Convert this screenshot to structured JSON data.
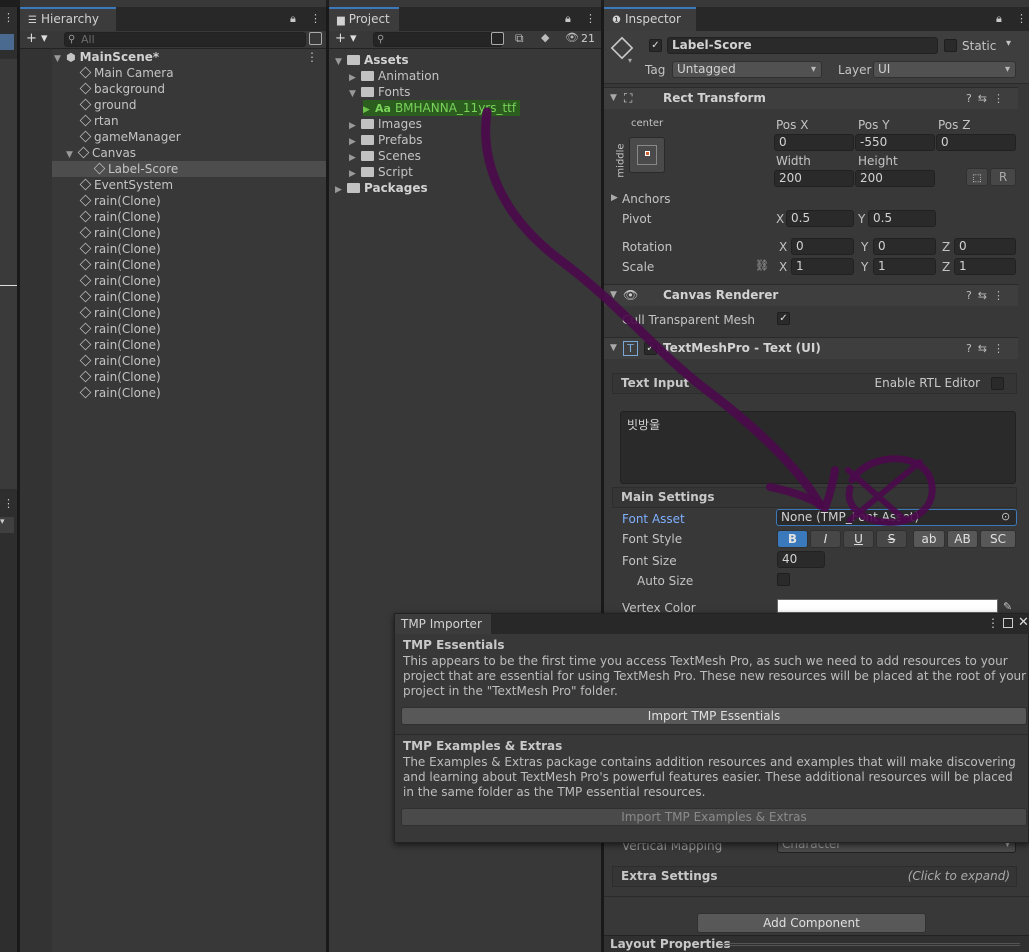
{
  "hierarchy": {
    "tab": "Hierarchy",
    "search_placeholder": "All",
    "scene": "MainScene*",
    "items": [
      {
        "label": "Main Camera",
        "depth": 1
      },
      {
        "label": "background",
        "depth": 1
      },
      {
        "label": "ground",
        "depth": 1
      },
      {
        "label": "rtan",
        "depth": 1
      },
      {
        "label": "gameManager",
        "depth": 1
      },
      {
        "label": "Canvas",
        "depth": 1,
        "expanded": true
      },
      {
        "label": "Label-Score",
        "depth": 2,
        "selected": true
      },
      {
        "label": "EventSystem",
        "depth": 1
      },
      {
        "label": "rain(Clone)",
        "depth": 1
      },
      {
        "label": "rain(Clone)",
        "depth": 1
      },
      {
        "label": "rain(Clone)",
        "depth": 1
      },
      {
        "label": "rain(Clone)",
        "depth": 1
      },
      {
        "label": "rain(Clone)",
        "depth": 1
      },
      {
        "label": "rain(Clone)",
        "depth": 1
      },
      {
        "label": "rain(Clone)",
        "depth": 1
      },
      {
        "label": "rain(Clone)",
        "depth": 1
      },
      {
        "label": "rain(Clone)",
        "depth": 1
      },
      {
        "label": "rain(Clone)",
        "depth": 1
      },
      {
        "label": "rain(Clone)",
        "depth": 1
      },
      {
        "label": "rain(Clone)",
        "depth": 1
      },
      {
        "label": "rain(Clone)",
        "depth": 1
      }
    ]
  },
  "project": {
    "tab": "Project",
    "hidden_count": "21",
    "items": [
      {
        "label": "Assets",
        "depth": 0,
        "expanded": true,
        "bold": true
      },
      {
        "label": "Animation",
        "depth": 1
      },
      {
        "label": "Fonts",
        "depth": 1,
        "expanded": true
      },
      {
        "label": "BMHANNA_11yrs_ttf",
        "depth": 2,
        "font": true,
        "prefix": "Aa"
      },
      {
        "label": "Images",
        "depth": 1
      },
      {
        "label": "Prefabs",
        "depth": 1
      },
      {
        "label": "Scenes",
        "depth": 1
      },
      {
        "label": "Script",
        "depth": 1
      },
      {
        "label": "Packages",
        "depth": 0,
        "bold": true
      }
    ]
  },
  "inspector": {
    "tab": "Inspector",
    "object_name": "Label-Score",
    "static_label": "Static",
    "tag_label": "Tag",
    "tag_value": "Untagged",
    "layer_label": "Layer",
    "layer_value": "UI",
    "rect_transform": {
      "title": "Rect Transform",
      "anchor_h": "center",
      "anchor_v": "middle",
      "pos_x_label": "Pos X",
      "pos_x": "0",
      "pos_y_label": "Pos Y",
      "pos_y": "-550",
      "pos_z_label": "Pos Z",
      "pos_z": "0",
      "width_label": "Width",
      "width": "200",
      "height_label": "Height",
      "height": "200",
      "r_button": "R",
      "anchors_label": "Anchors",
      "pivot_label": "Pivot",
      "pivot_x": "0.5",
      "pivot_y": "0.5",
      "rotation_label": "Rotation",
      "rot_x": "0",
      "rot_y": "0",
      "rot_z": "0",
      "scale_label": "Scale",
      "scale_x": "1",
      "scale_y": "1",
      "scale_z": "1",
      "x": "X",
      "y": "Y",
      "z": "Z"
    },
    "canvas_renderer": {
      "title": "Canvas Renderer",
      "cull_label": "Cull Transparent Mesh"
    },
    "tmp": {
      "title": "TextMeshPro - Text (UI)",
      "text_input": "Text Input",
      "rtl": "Enable RTL Editor",
      "text_value": "빗방울",
      "main_settings": "Main Settings",
      "font_asset_label": "Font Asset",
      "font_asset_value": "None (TMP_Font Asset)",
      "font_style_label": "Font Style",
      "style_buttons": [
        "B",
        "I",
        "U",
        "S",
        "ab",
        "AB",
        "SC"
      ],
      "font_size_label": "Font Size",
      "font_size_value": "40",
      "auto_size_label": "Auto Size",
      "vertex_color_label": "Vertex Color",
      "vertical_mapping_label": "Vertical Mapping",
      "vertical_mapping_value": "Character",
      "extra_settings": "Extra Settings",
      "click_to_expand": "(Click to expand)"
    },
    "add_component": "Add Component",
    "layout_properties": "Layout Properties"
  },
  "tmp_importer": {
    "title": "TMP Importer",
    "essentials_title": "TMP Essentials",
    "essentials_text": "This appears to be the first time you access TextMesh Pro, as such we need to add resources to your project that are essential for using TextMesh Pro. These new resources will be placed at the root of your project in the \"TextMesh Pro\" folder.",
    "essentials_button": "Import TMP Essentials",
    "extras_title": "TMP Examples & Extras",
    "extras_text": "The Examples & Extras package contains addition resources and examples that will make discovering and learning about TextMesh Pro's powerful features easier. These additional resources will be placed in the same folder as the TMP essential resources.",
    "extras_button": "Import TMP Examples & Extras"
  },
  "colors": {
    "accent": "#3a79bb",
    "annotation": "#4b0a4b",
    "font_highlight": "#2b5d1e",
    "link_blue": "#7fb0ff"
  }
}
